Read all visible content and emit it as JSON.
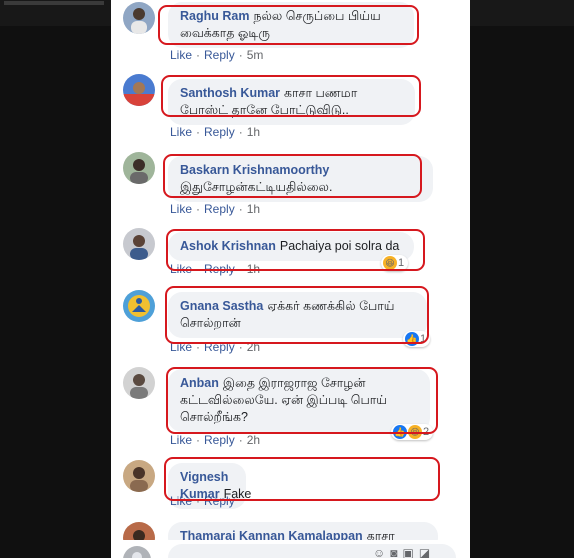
{
  "comments": [
    {
      "author": "Raghu Ram",
      "text": "நல்ல செருப்பை பிய்ய வைக்காத ஓடிரு",
      "actions": {
        "like": "Like",
        "reply": "Reply",
        "time": "5m"
      }
    },
    {
      "author": "Santhosh Kumar",
      "text": "காசா பணமா போஸ்ட் தானே போட்டுவிடு..",
      "actions": {
        "like": "Like",
        "reply": "Reply",
        "time": "1h"
      }
    },
    {
      "author": "Baskarn Krishnamoorthy",
      "text": "இதுசோழன்கட்டியதில்லை.",
      "actions": {
        "like": "Like",
        "reply": "Reply",
        "time": "1h"
      }
    },
    {
      "author": "Ashok Krishnan",
      "text": "Pachaiya poi solra da",
      "actions": {
        "like": "Like",
        "reply": "Reply",
        "time": "1h"
      },
      "reactions": {
        "count": "1",
        "types": [
          "haha-icon"
        ]
      }
    },
    {
      "author": "Gnana Sastha",
      "text": "ஏக்கர் கணக்கில் போய் சொல்றான்",
      "actions": {
        "like": "Like",
        "reply": "Reply",
        "time": "2h"
      },
      "reactions": {
        "count": "1",
        "types": [
          "like-icon"
        ]
      }
    },
    {
      "author": "Anban",
      "text": "இதை இராஜராஜ சோழன் கட்டவில்லையே. ஏன் இப்படி பொய் சொல்றீங்க?",
      "actions": {
        "like": "Like",
        "reply": "Reply",
        "time": "2h"
      },
      "reactions": {
        "count": "2",
        "types": [
          "like-icon",
          "haha-icon"
        ]
      }
    },
    {
      "author": "Vignesh Kumar",
      "text": "Fake",
      "actions": {
        "like": "Like",
        "reply": "Reply",
        "time": ""
      }
    },
    {
      "author": "Thamarai Kannan Kamalappan",
      "text": "காசா",
      "actions": {
        "like": "",
        "reply": "",
        "time": ""
      }
    }
  ],
  "highlight_color": "#d6181e",
  "link_color": "#385898"
}
